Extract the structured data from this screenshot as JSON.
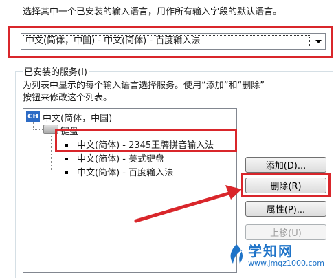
{
  "instruction_text": "选择其中一个已安装的输入语言，用作所有输入字段的默认语言。",
  "default_language": {
    "selected": "中文(简体，中国) - 中文(简体) - 百度输入法"
  },
  "services": {
    "group_label": "已安装的服务(I)",
    "description_line1": "为列表中显示的每个输入语言选择服务。使用“添加”和“删除”",
    "description_line2": "按钮来修改这个列表。",
    "tree": {
      "language_badge": "CH",
      "language": "中文(简体，中国)",
      "category": "键盘",
      "items": [
        "中文(简体) - 2345王牌拼音输入法",
        "中文(简体) - 美式键盘",
        "中文(简体) - 百度输入法"
      ]
    }
  },
  "buttons": {
    "add": "添加(D)...",
    "remove": "删除(R)",
    "properties": "属性(P)...",
    "move_up": "上移(U)"
  },
  "watermark": {
    "name": "学知网",
    "url": "www.jmqz1000.com"
  },
  "colors": {
    "highlight_red": "#d9262b",
    "watermark_blue": "#1e73c8"
  }
}
